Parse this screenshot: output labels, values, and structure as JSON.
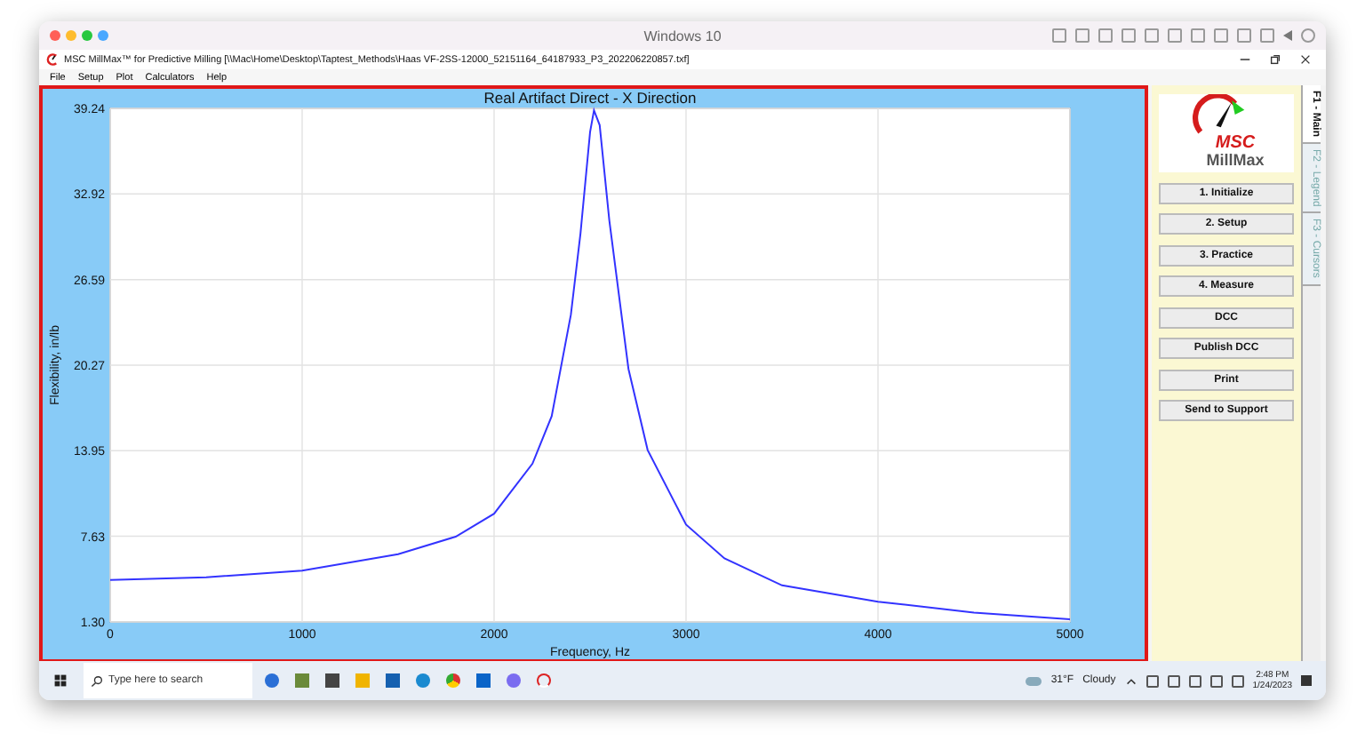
{
  "window": {
    "title": "Windows 10"
  },
  "app": {
    "title": "MSC MillMax™ for Predictive Milling [\\\\Mac\\Home\\Desktop\\Taptest_Methods\\Haas VF-2SS-12000_52151164_64187933_P3_202206220857.txf]"
  },
  "menu": [
    "File",
    "Setup",
    "Plot",
    "Calculators",
    "Help"
  ],
  "chart": {
    "chart_data": {
      "type": "line",
      "title": "Real Artifact Direct - X Direction",
      "xlabel": "Frequency, Hz",
      "ylabel": "Flexibility, in/lb",
      "grid": true,
      "xlim": [
        0,
        5000
      ],
      "ylim": [
        1.3,
        39.24
      ],
      "xticks": [
        0,
        1000,
        2000,
        3000,
        4000,
        5000
      ],
      "yticks": [
        {
          "value": 1.3,
          "label": "1.30"
        },
        {
          "value": 7.63,
          "label": "7.63"
        },
        {
          "value": 13.95,
          "label": "13.95"
        },
        {
          "value": 20.27,
          "label": "20.27"
        },
        {
          "value": 26.59,
          "label": "26.59"
        },
        {
          "value": 32.92,
          "label": "32.92"
        },
        {
          "value": 39.24,
          "label": "39.24"
        }
      ],
      "x": [
        0,
        500,
        1000,
        1500,
        1800,
        2000,
        2200,
        2300,
        2400,
        2450,
        2500,
        2520,
        2550,
        2600,
        2700,
        2800,
        3000,
        3200,
        3500,
        4000,
        4500,
        5000
      ],
      "series": [
        {
          "color": "#3333ff",
          "values": [
            4.4,
            4.6,
            5.1,
            6.3,
            7.6,
            9.3,
            13,
            16.5,
            24,
            30,
            37.5,
            39.1,
            38,
            31,
            20,
            14,
            8.5,
            6,
            4,
            2.8,
            2,
            1.5
          ]
        }
      ]
    }
  },
  "logo": {
    "brand": "MSC",
    "product": "MillMax"
  },
  "buttons": [
    "1. Initialize",
    "2. Setup",
    "3. Practice",
    "4. Measure",
    "DCC",
    "Publish DCC",
    "Print",
    "Send to Support"
  ],
  "side_tabs": [
    {
      "label": "F1 - Main",
      "selected": true
    },
    {
      "label": "F2 - Legend",
      "selected": false
    },
    {
      "label": "F3 - Cursors",
      "selected": false
    }
  ],
  "taskbar": {
    "search": {
      "placeholder": "Type here to search"
    },
    "weather": {
      "temp": "31°F",
      "condition": "Cloudy"
    },
    "time": "2:48 PM",
    "date": "1/24/2023"
  }
}
